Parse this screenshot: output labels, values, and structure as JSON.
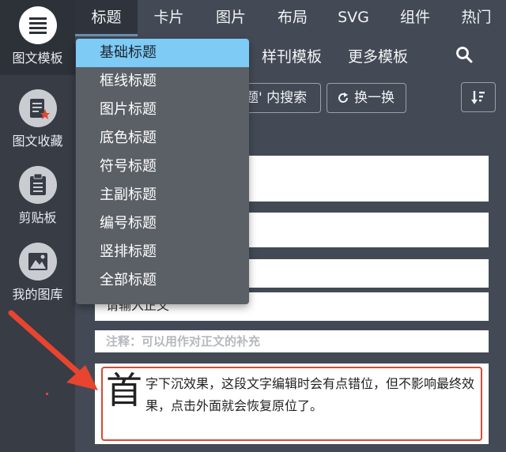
{
  "sidebar": {
    "items": [
      {
        "label": "图文模板",
        "icon": "list-icon"
      },
      {
        "label": "图文收藏",
        "icon": "document-star-icon"
      },
      {
        "label": "剪贴板",
        "icon": "clipboard-icon"
      },
      {
        "label": "我的图库",
        "icon": "image-icon"
      }
    ]
  },
  "topnav": {
    "tabs": [
      "标题",
      "卡片",
      "图片",
      "布局",
      "SVG",
      "组件",
      "热门"
    ]
  },
  "subnav": {
    "tabs": [
      "样刊模板",
      "更多模板"
    ]
  },
  "toolbar": {
    "search_in_label": "题' 内搜索",
    "shuffle_label": "换一换"
  },
  "dropdown": {
    "items": [
      "基础标题",
      "框线标题",
      "图片标题",
      "底色标题",
      "符号标题",
      "主副标题",
      "编号标题",
      "竖排标题",
      "全部标题"
    ]
  },
  "content": {
    "body_placeholder": "请输入正文",
    "note": "注释：可以用作对正文的补充",
    "dropcap_char": "首",
    "dropcap_text": "字下沉效果，这段文字编辑时会有点错位，但不影响最终效果，点击外面就会恢复原位了。"
  },
  "colors": {
    "background": "#434a55",
    "sidebar": "#373c45",
    "dropdown": "#5b5f66",
    "dropdown_active": "#7ecbf5",
    "highlight_red": "#d94a35"
  }
}
